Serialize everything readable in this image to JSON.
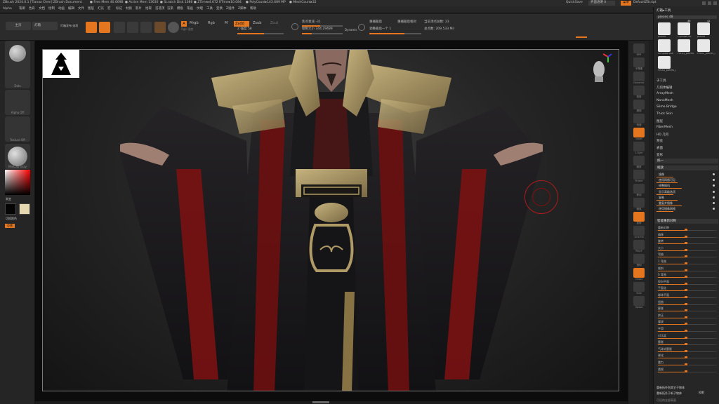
{
  "titlebar": {
    "app": "ZBrush 2024.0.1 [Tianao Chen]   ZBrush Document",
    "free_mem": "● Free Mem 40.669B",
    "active_mem": "● Active Mem 13630",
    "scratch": "● Scratch Disk 1086",
    "ztime": "● ZTime▸4.672 RTime▸10.084",
    "polycount": "● PolyCount▸143.689 MP",
    "meshcount": "● MeshCount▸32",
    "quicksave": "QuickSave",
    "transparency": "界面透明 0",
    "menu_btn": "菜单",
    "script": "DefaultZScript"
  },
  "menubar": {
    "items": [
      "Alpha",
      "笔刷",
      "色彩",
      "文档",
      "绘制",
      "动画",
      "编辑",
      "文件",
      "图层",
      "灯光",
      "宏",
      "标记",
      "材质",
      "影片",
      "拾取",
      "首选项",
      "渲染",
      "模板",
      "笔画",
      "纹理",
      "工具",
      "变换",
      "Z插件",
      "Z脚本",
      "帮助"
    ]
  },
  "toolbar": {
    "home": "主页",
    "lightbox": "灯箱",
    "lightbox_tools": "灯箱发布·选项",
    "buttons": [
      "编辑",
      "绘制",
      "移动",
      "缩放",
      "旋转"
    ],
    "a_label": "A",
    "mrgb": "Mrgb",
    "rgb": "Rgb",
    "m": "M",
    "zadd": "Zadd",
    "zsub": "Zsub",
    "zcut": "Zcut",
    "rgb_intensity": "Rgb 强度",
    "z_intensity": "Z 强度 58",
    "focal": "焦点衰减 -31",
    "draw_size": "绘制大小 344.29489",
    "dynamic": "Dynamic",
    "replay_last": "重播最后",
    "replay_last_rel": "重播最后相对",
    "active_points": "当前顶点总数: 23",
    "total_points": "总点数: 209.533 Mil",
    "adjust_last": "调整最后一个 1"
  },
  "leftshelf": {
    "brush": "Move",
    "stroke": "Dots",
    "alpha": "Alpha Off",
    "texture": "Texture Off",
    "material": "MatCap Gray",
    "gradient": "渐变",
    "switch_color": "切换颜色",
    "alternate": "交替"
  },
  "rightshelf": {
    "items": [
      "BPR",
      "子像素",
      "Dynamic",
      "视角",
      "透视",
      "地面",
      "Local",
      "L.Sym",
      "缩放",
      "Frame",
      "移动",
      "缩放",
      "旋转",
      "Line Fill",
      "PolyF",
      "透明",
      "Ghost",
      "Solo",
      "Xpose"
    ]
  },
  "palette": {
    "title": "灯箱▸工具",
    "pieces_label": "pieces 48",
    "tools": [
      {
        "name": "pieces",
        "count": ""
      },
      {
        "name": "Cylinder3D",
        "count": "48"
      },
      {
        "name": "pieces",
        "count": "42"
      },
      {
        "name": "SimpleBrush",
        "count": ""
      },
      {
        "name": "PM3D_pieces",
        "count": ""
      },
      {
        "name": "PM3D_pieces_3",
        "count": ""
      },
      {
        "name": "PM3D_pieces_1",
        "count": ""
      }
    ],
    "subtools": [
      "子工具",
      "几何体编辑",
      "ArrayMesh",
      "NanoMesh",
      "Slime Bridge",
      "Thick Skin",
      "图层",
      "FiberMesh",
      "HD 几何",
      "预览",
      "表面",
      "变形"
    ],
    "section1": "统一",
    "deform_header": "缩放",
    "toggles": [
      "镜像",
      "使用网格可见",
      "修整随机",
      "显示高级选项",
      "复制",
      "重复并镜像",
      "使用镜像网格"
    ],
    "smart_resym": "智能重新对称",
    "deform_sliders": [
      {
        "label": "重新对称",
        "value": 0.5
      },
      {
        "label": "偏移",
        "value": 0.5
      },
      {
        "label": "旋转",
        "value": 0.5
      },
      {
        "label": "大小",
        "value": 0.5
      },
      {
        "label": "弯曲",
        "value": 0.5
      },
      {
        "label": "1 弯曲",
        "value": 0.5
      },
      {
        "label": "倾斜",
        "value": 0.5
      },
      {
        "label": "S 弯曲",
        "value": 0.5
      },
      {
        "label": "投向平面",
        "value": 0.5
      },
      {
        "label": "平面化",
        "value": 0.5
      },
      {
        "label": "球体平面",
        "value": 0.5
      },
      {
        "label": "扭曲",
        "value": 0.5
      },
      {
        "label": "膨胀",
        "value": 0.5
      },
      {
        "label": "挤压",
        "value": 0.5
      },
      {
        "label": "噪波",
        "value": 0.5
      },
      {
        "label": "平滑",
        "value": 0.5
      },
      {
        "label": "对比度",
        "value": 0.5
      },
      {
        "label": "膨胀",
        "value": 0.5
      },
      {
        "label": "气球式膨胀",
        "value": 0.5
      },
      {
        "label": "球化",
        "value": 0.5
      },
      {
        "label": "重力",
        "value": 0.5
      },
      {
        "label": "透视",
        "value": 0.5
      }
    ],
    "footer1": "重新拓扑到其它子物体",
    "footer2": "重新拓扑于新子物体",
    "footer3": "投影",
    "footer4": "可见的全部表面"
  },
  "colors": {
    "accent": "#e3761f",
    "robe_black": "#1c1b1d",
    "robe_red": "#7a1212",
    "gold": "#b09a66",
    "skin": "#a07f73"
  }
}
